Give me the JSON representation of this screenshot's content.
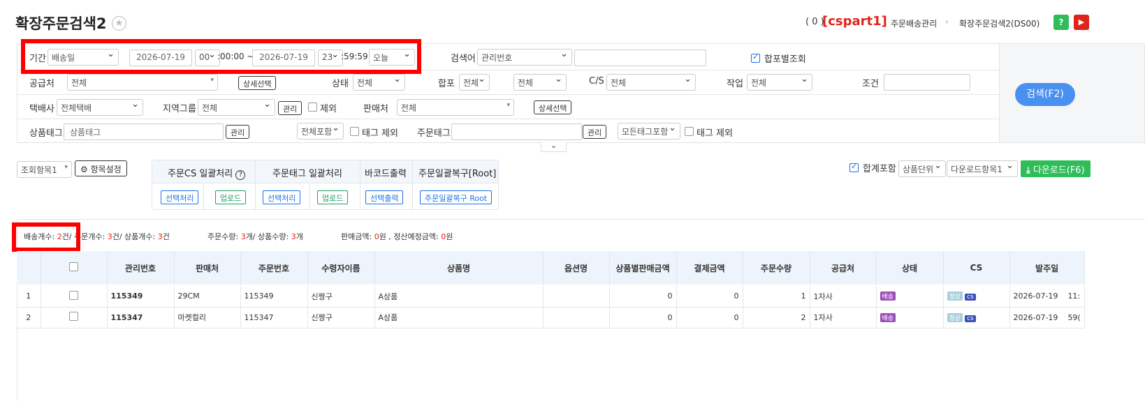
{
  "header": {
    "title": "확장주문검색2",
    "count": "( 0 )",
    "user": "[cspart1]",
    "breadcrumb": [
      "주문배송관리",
      "확장주문검색2(DS00)"
    ],
    "help": "?",
    "video": "▶"
  },
  "filters": {
    "period_label": "기간",
    "period_type": "배송일",
    "date_from": "2026-07-19",
    "hour_from": "00",
    "time_from_suffix": ":00:00 ~",
    "date_to": "2026-07-19",
    "hour_to": "23",
    "time_to_suffix": ":59:59",
    "range_preset": "오늘",
    "keyword_label": "검색어",
    "keyword_type": "관리번호",
    "keyword_value": "",
    "merge_view_label": "합포별조회",
    "supplier_label": "공급처",
    "supplier_value": "전체",
    "detail_select": "상세선택",
    "status_label": "상태",
    "status_value": "전체",
    "merge_label": "합포",
    "merge_value": "전체",
    "merge_value2": "전체",
    "cs_label": "C/S",
    "cs_value": "전체",
    "work_label": "작업",
    "work_value": "전체",
    "condition_label": "조건",
    "courier_label": "택배사",
    "courier_value": "전체택배",
    "region_label": "지역그룹",
    "region_value": "전체",
    "manage": "관리",
    "exclude": "제외",
    "seller_label": "판매처",
    "seller_value": "전체",
    "product_tag_label": "상품태그",
    "product_tag_placeholder": "상품태그",
    "include_all": "전체포함",
    "tag_exclude": "태그 제외",
    "order_tag_label": "주문태그",
    "all_tags_include": "모든태그포함",
    "search_button": "검색(F2)"
  },
  "toolbar": {
    "view_items": "조회항목1",
    "item_settings": "항목설정",
    "batch_groups": [
      {
        "title": "주문CS 일괄처리",
        "buttons": [
          "선택처리",
          "업로드"
        ]
      },
      {
        "title": "주문태그 일괄처리",
        "buttons": [
          "선택처리",
          "업로드"
        ]
      },
      {
        "title": "바코드출력",
        "buttons": [
          "선택출력"
        ]
      },
      {
        "title": "주문일괄복구[Root]",
        "buttons": [
          "주문일괄복구 Root"
        ]
      }
    ],
    "sum_include": "합계포함",
    "unit": "상품단위",
    "download_items": "다운로드항목1",
    "download": "다운로드(F6)"
  },
  "summary": {
    "delivery_label": "배송개수:",
    "delivery_count": "2",
    "delivery_unit": "건/",
    "order_label": "주문개수:",
    "order_count": "3",
    "order_unit": "건/",
    "product_label": "상품개수:",
    "product_count": "3",
    "product_unit": "건",
    "order_qty_label": "주문수량:",
    "order_qty": "3",
    "order_qty_unit": "개/",
    "product_qty_label": "상품수량:",
    "product_qty": "3",
    "product_qty_unit": "개",
    "sales_label": "판매금액:",
    "sales": "0",
    "sales_unit": "원 ,",
    "settle_label": "정산예정금액:",
    "settle": "0",
    "settle_unit": "원"
  },
  "table": {
    "columns": [
      "",
      "",
      "관리번호",
      "판매처",
      "주문번호",
      "수령자이름",
      "상품명",
      "옵션명",
      "상품별판매금액",
      "결제금액",
      "주문수량",
      "공급처",
      "상태",
      "CS",
      "발주일"
    ],
    "rows": [
      {
        "no": "1",
        "mgmt": "115349",
        "seller": "29CM",
        "order": "115349",
        "receiver": "신짱구",
        "product": "A상품",
        "option": "",
        "sale_amt": "0",
        "pay_amt": "0",
        "qty": "1",
        "supplier": "1자사",
        "status": "배송",
        "cs1": "정상",
        "cs2": "cs",
        "date": "2026-07-19",
        "extra": "11:"
      },
      {
        "no": "2",
        "mgmt": "115347",
        "seller": "마켓컬리",
        "order": "115347",
        "receiver": "신짱구",
        "product": "A상품",
        "option": "",
        "sale_amt": "0",
        "pay_amt": "0",
        "qty": "2",
        "supplier": "1자사",
        "status": "배송",
        "cs1": "정상",
        "cs2": "cs",
        "date": "2026-07-19",
        "extra": "59("
      }
    ]
  },
  "colors": {
    "accent": "#1a73e8",
    "search_btn": "#4a90f0",
    "download": "#2ebd59",
    "highlight": "#ff0000",
    "count_red": "#e0241b"
  }
}
